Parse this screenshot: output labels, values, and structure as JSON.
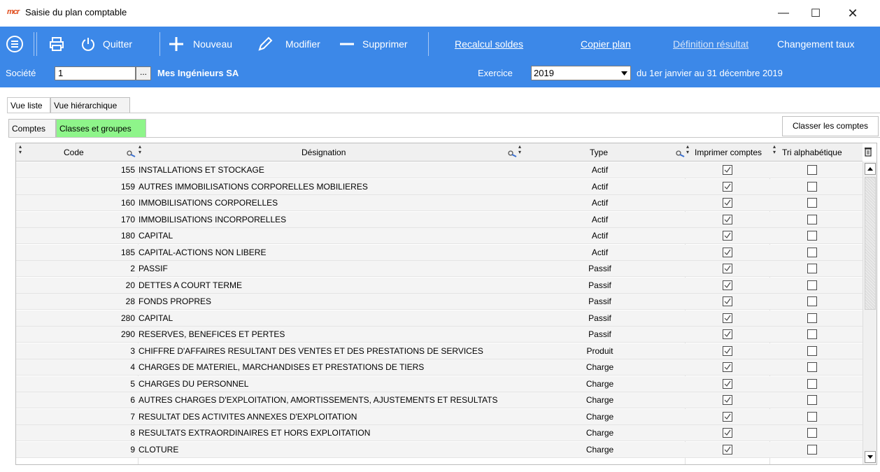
{
  "window": {
    "logo": "mcr",
    "title": "Saisie du plan comptable",
    "minimize": "—",
    "maximize": "☐",
    "close": "✕"
  },
  "toolbar": {
    "quitter": "Quitter",
    "nouveau": "Nouveau",
    "modifier": "Modifier",
    "supprimer": "Supprimer",
    "recalcul": "Recalcul soldes",
    "copier": "Copier plan",
    "definition": "Définition résultat",
    "changement": "Changement taux"
  },
  "societe": {
    "label": "Société",
    "value": "1",
    "lookup": "...",
    "name": "Mes Ingénieurs SA",
    "exercice_label": "Exercice",
    "exercice_value": "2019",
    "exercice_range": "du 1er janvier au 31 décembre 2019"
  },
  "tabs": [
    "Vue liste",
    "Vue hiérarchique"
  ],
  "subtabs": [
    "Comptes",
    "Classes et groupes"
  ],
  "classer_button": "Classer les comptes",
  "grid": {
    "columns": {
      "code": "Code",
      "designation": "Désignation",
      "type": "Type",
      "imprimer": "Imprimer comptes",
      "tri": "Tri alphabétique"
    },
    "rows": [
      {
        "code": "155",
        "designation": "INSTALLATIONS ET STOCKAGE",
        "type": "Actif",
        "imprimer": true,
        "tri": false
      },
      {
        "code": "159",
        "designation": "AUTRES IMMOBILISATIONS CORPORELLES MOBILIERES",
        "type": "Actif",
        "imprimer": true,
        "tri": false
      },
      {
        "code": "160",
        "designation": "IMMOBILISATIONS CORPORELLES",
        "type": "Actif",
        "imprimer": true,
        "tri": false
      },
      {
        "code": "170",
        "designation": "IMMOBILISATIONS INCORPORELLES",
        "type": "Actif",
        "imprimer": true,
        "tri": false
      },
      {
        "code": "180",
        "designation": "CAPITAL",
        "type": "Actif",
        "imprimer": true,
        "tri": false
      },
      {
        "code": "185",
        "designation": "CAPITAL-ACTIONS NON LIBERE",
        "type": "Actif",
        "imprimer": true,
        "tri": false
      },
      {
        "code": "2",
        "designation": "PASSIF",
        "type": "Passif",
        "imprimer": true,
        "tri": false
      },
      {
        "code": "20",
        "designation": "DETTES A COURT TERME",
        "type": "Passif",
        "imprimer": true,
        "tri": false
      },
      {
        "code": "28",
        "designation": "FONDS PROPRES",
        "type": "Passif",
        "imprimer": true,
        "tri": false
      },
      {
        "code": "280",
        "designation": "CAPITAL",
        "type": "Passif",
        "imprimer": true,
        "tri": false
      },
      {
        "code": "290",
        "designation": "RESERVES, BENEFICES ET PERTES",
        "type": "Passif",
        "imprimer": true,
        "tri": false
      },
      {
        "code": "3",
        "designation": "CHIFFRE D'AFFAIRES RESULTANT DES VENTES ET DES PRESTATIONS DE SERVICES",
        "type": "Produit",
        "imprimer": true,
        "tri": false
      },
      {
        "code": "4",
        "designation": "CHARGES DE MATERIEL, MARCHANDISES ET PRESTATIONS DE TIERS",
        "type": "Charge",
        "imprimer": true,
        "tri": false
      },
      {
        "code": "5",
        "designation": "CHARGES DU PERSONNEL",
        "type": "Charge",
        "imprimer": true,
        "tri": false
      },
      {
        "code": "6",
        "designation": "AUTRES CHARGES D'EXPLOITATION, AMORTISSEMENTS, AJUSTEMENTS ET RESULTATS",
        "type": "Charge",
        "imprimer": true,
        "tri": false
      },
      {
        "code": "7",
        "designation": "RESULTAT DES ACTIVITES ANNEXES D'EXPLOITATION",
        "type": "Charge",
        "imprimer": true,
        "tri": false
      },
      {
        "code": "8",
        "designation": "RESULTATS EXTRAORDINAIRES ET HORS EXPLOITATION",
        "type": "Charge",
        "imprimer": true,
        "tri": false
      },
      {
        "code": "9",
        "designation": "CLOTURE",
        "type": "Charge",
        "imprimer": true,
        "tri": false
      }
    ]
  },
  "colors": {
    "toolbar_blue": "#3c88e8",
    "green_tab": "#8ef58a",
    "logo_red": "#e04b1a"
  }
}
